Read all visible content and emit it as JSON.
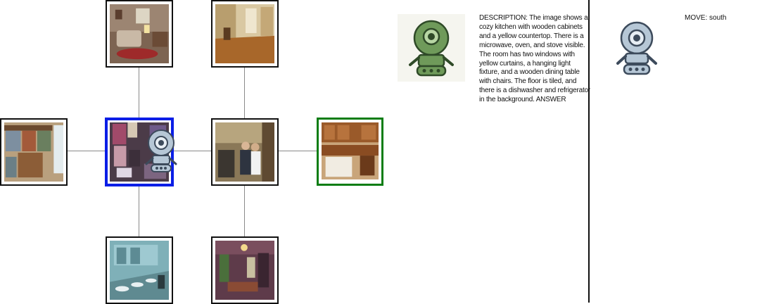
{
  "map": {
    "rooms": [
      {
        "id": "bedroom-sitting-top-left",
        "scene": "sitting room with sofa, lamp and red rug"
      },
      {
        "id": "empty-hallway-top-right",
        "scene": "empty room with hardwood floor"
      },
      {
        "id": "closet-left",
        "scene": "walk-in closet with wooden shelves"
      },
      {
        "id": "current-room",
        "scene": "cluttered room",
        "state": "current"
      },
      {
        "id": "people-room-center-right",
        "scene": "room with people standing"
      },
      {
        "id": "kitchen-right",
        "scene": "kitchen with wooden cabinets",
        "state": "target"
      },
      {
        "id": "bathroom-bottom-left",
        "scene": "bathroom with row of sinks and mirror"
      },
      {
        "id": "dining-bottom-right",
        "scene": "dining room with chandelier"
      }
    ],
    "colors": {
      "current": "#0a1ee6",
      "target": "#0a7d14",
      "edge": "#8a8a8a"
    }
  },
  "agent": {
    "icon": "robot-icon",
    "color_map": "#8aa0b8",
    "color_panel": "#6f9a5a"
  },
  "description": "DESCRIPTION: The image shows a cozy kitchen with wooden cabinets and a yellow countertop. There is a microwave, oven, and stove visible. The room has two windows with yellow curtains, a hanging light fixture, and a wooden dining table with chairs. The floor is tiled, and there is a dishwasher and refrigerator in the background.  ANSWER",
  "move": "MOVE: south"
}
